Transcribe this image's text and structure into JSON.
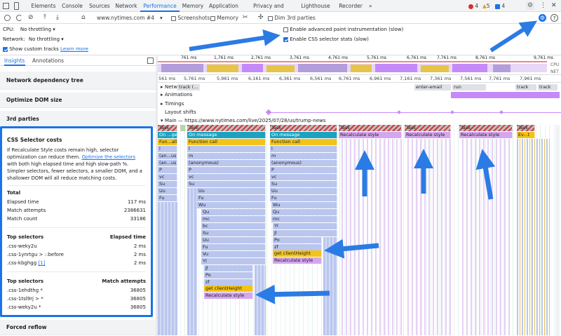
{
  "tabs": {
    "items": [
      "Elements",
      "Console",
      "Sources",
      "Network",
      "Performance",
      "Memory",
      "Application",
      "Privacy and security",
      "Lighthouse",
      "Recorder"
    ],
    "active": "Performance"
  },
  "status": {
    "errors": "4",
    "warnings": "5",
    "info": "4"
  },
  "toolbar": {
    "recording": "www.nytimes.com #4",
    "screenshots": "Screenshots",
    "memory": "Memory",
    "dim_third_parties": "Dim 3rd parties"
  },
  "settings": {
    "cpu_label": "CPU:",
    "cpu_value": "No throttling",
    "network_label": "Network:",
    "network_value": "No throttling",
    "custom_tracks": "Show custom tracks",
    "learn_more": "Learn more",
    "advanced_paint": "Enable advanced paint instrumentation (slow)",
    "css_selector_stats": "Enable CSS selector stats (slow)"
  },
  "left_tabs": [
    "Insights",
    "Annotations"
  ],
  "insights": [
    "Network dependency tree",
    "Optimize DOM size",
    "3rd parties"
  ],
  "css_card": {
    "title": "CSS Selector costs",
    "desc_before": "If Recalculate Style costs remain high, selector optimization can reduce them. ",
    "desc_link": "Optimize the selectors",
    "desc_after": " with both high elapsed time and high slow-path %. Simpler selectors, fewer selectors, a smaller DOM, and a shallower DOM will all reduce matching costs.",
    "total_label": "Total",
    "elapsed_label": "Elapsed time",
    "elapsed_value": "117 ms",
    "attempts_label": "Match attempts",
    "attempts_value": "2386631",
    "count_label": "Match count",
    "count_value": "33186",
    "top_selectors_label": "Top selectors",
    "elapsed_col": "Elapsed time",
    "top_by_time": [
      {
        "sel": ".css-weky2u",
        "val": "2 ms"
      },
      {
        "sel": ".css-1ynrtgu > ::before",
        "val": "2 ms"
      },
      {
        "sel": ".css-kbghgg",
        "val": "2 ms",
        "link": "[1]"
      }
    ],
    "attempts_col": "Match attempts",
    "top_by_attempts": [
      {
        "sel": ".css-1ehdthg *",
        "val": "36805"
      },
      {
        "sel": ".css-1tsl9rj > *",
        "val": "36805"
      },
      {
        "sel": ".css-weky2u *",
        "val": "36805"
      }
    ]
  },
  "forced_reflow": "Forced reflow",
  "overview_ticks": [
    "761 ms",
    "1,761 ms",
    "2,761 ms",
    "3,761 ms",
    "4,761 ms",
    "5,761 ms",
    "6,761 ms",
    "7,761 ms",
    "8,761 ms",
    "9,761 ms"
  ],
  "overview_labels": {
    "cpu": "CPU",
    "net": "NET"
  },
  "ruler_ticks": [
    "561 ms",
    "5,761 ms",
    "5,961 ms",
    "6,161 ms",
    "6,361 ms",
    "6,561 ms",
    "6,761 ms",
    "6,961 ms",
    "7,161 ms",
    "7,361 ms",
    "7,561 ms",
    "7,761 ms",
    "7,961 ms"
  ],
  "tracks": {
    "network": "Network",
    "network_items": [
      "track (...",
      "enter-email (www...",
      "run (browse...",
      "track (...",
      "track (..."
    ],
    "animations": "Animations",
    "timings": "Timings",
    "layout_shifts": "Layout shifts",
    "main": "Main — https://www.nytimes.com/live/2025/07/28/us/trump-news"
  },
  "flame": {
    "col1": [
      "Task",
      "On ...ge",
      "Fun...all",
      "l",
      "(an...us)",
      "(an...us)",
      "P",
      "vc",
      "Su",
      "Uu",
      "Fu"
    ],
    "col2": [
      "Task",
      "On message",
      "Function call",
      "l",
      "m",
      "(anonymous)",
      "P",
      "vc",
      "Su",
      "Uu",
      "Fu",
      "Wu",
      "Qu",
      "mc",
      "bc",
      "Su",
      "Uu",
      "Fu",
      "Vu",
      "Yl",
      "Jl",
      "Po",
      "zf",
      "get clientHeight",
      "Recalculate style"
    ],
    "col3": [
      "Task",
      "On message",
      "Function call",
      "l",
      "m",
      "(anonymous)",
      "P",
      "vc",
      "Su",
      "Uu",
      "Fu",
      "Wu",
      "Qu",
      "mc",
      "Yl",
      "Jl",
      "Po",
      "zf",
      "get clientHeight",
      "Recalculate style"
    ],
    "col4": [
      "Task",
      "Recalculate style"
    ],
    "col5": [
      "Task",
      "Recalculate style"
    ],
    "col6": [
      "Task",
      "Recalculate style"
    ],
    "col7": [
      "Task",
      "Ev...t"
    ]
  }
}
